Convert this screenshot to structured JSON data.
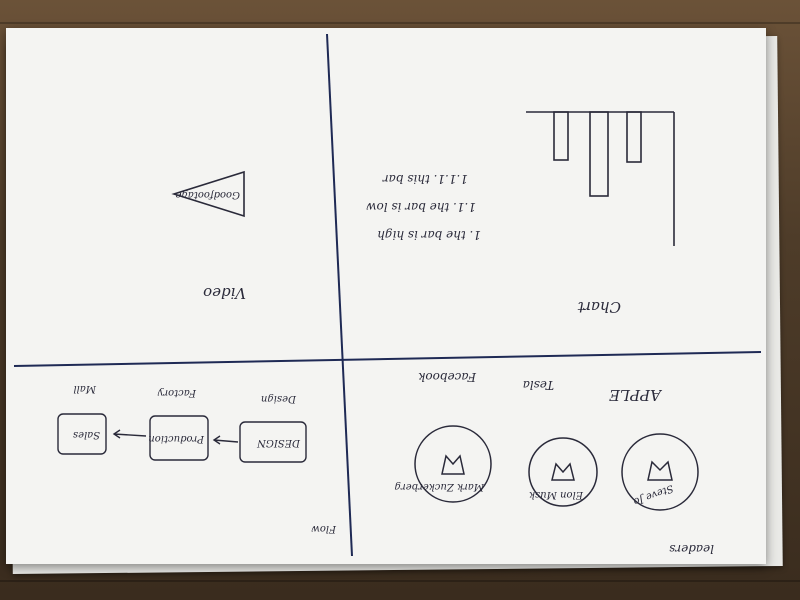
{
  "sections": {
    "chart": {
      "title": "Chart",
      "notes": [
        "1. the bar is high",
        "1.1. the bar is low",
        "1.1.1. this bar"
      ]
    },
    "video": {
      "title": "Video",
      "play_label": "Goodfootage"
    },
    "leaders": {
      "title": "leaders",
      "companies": [
        {
          "company": "APPLE",
          "person": "Steve Jo"
        },
        {
          "company": "Tesla",
          "person": "Elon Musk"
        },
        {
          "company": "Facebook",
          "person": "Mark Zuckerberg"
        }
      ]
    },
    "flow": {
      "title": "Flow",
      "steps": [
        {
          "caption": "Design",
          "box": "DESIGN"
        },
        {
          "caption": "Factory",
          "box": "Production"
        },
        {
          "caption": "Mall",
          "box": "Sales"
        }
      ]
    }
  }
}
